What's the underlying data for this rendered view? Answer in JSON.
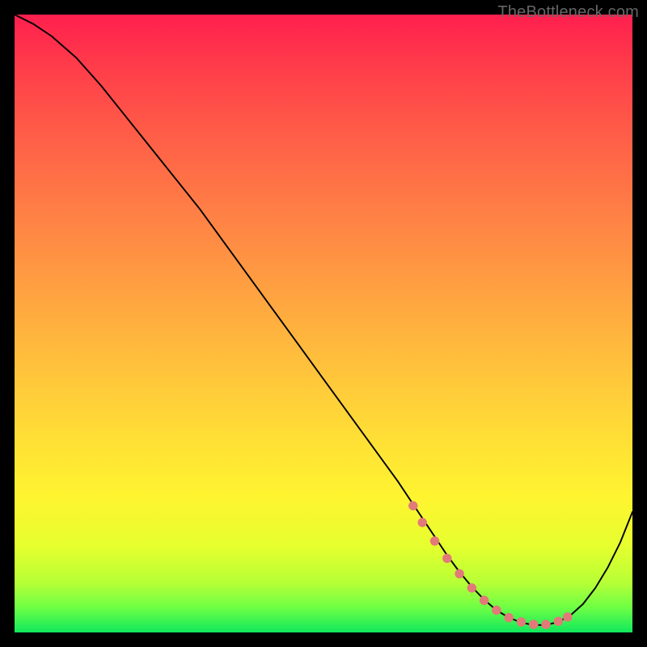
{
  "watermark": "TheBottleneck.com",
  "chart_data": {
    "type": "line",
    "title": "",
    "xlabel": "",
    "ylabel": "",
    "xlim": [
      0,
      100
    ],
    "ylim": [
      0,
      100
    ],
    "grid": false,
    "series": [
      {
        "name": "bottleneck-curve",
        "x": [
          0,
          3,
          6,
          10,
          14,
          18,
          22,
          26,
          30,
          34,
          38,
          42,
          46,
          50,
          54,
          58,
          62,
          64,
          66,
          68,
          70,
          72,
          74,
          76,
          78,
          80,
          82,
          84,
          86,
          88,
          90,
          92,
          94,
          96,
          98,
          100
        ],
        "y": [
          100,
          98.5,
          96.5,
          93,
          88.5,
          83.5,
          78.5,
          73.5,
          68.5,
          63,
          57.5,
          52,
          46.5,
          41,
          35.5,
          30,
          24.5,
          21.5,
          18.5,
          15.5,
          12.5,
          9.8,
          7.4,
          5.3,
          3.6,
          2.4,
          1.6,
          1.2,
          1.2,
          1.7,
          2.8,
          4.6,
          7.2,
          10.5,
          14.5,
          19.5
        ]
      }
    ],
    "annotations": {
      "minimum_band": {
        "color": "#e27a79",
        "points_x": [
          64.5,
          66,
          68,
          70,
          72,
          74,
          76,
          78,
          80,
          82,
          84,
          86,
          88,
          89.5
        ],
        "points_y": [
          20.5,
          17.8,
          14.8,
          12,
          9.5,
          7.2,
          5.2,
          3.6,
          2.4,
          1.7,
          1.3,
          1.3,
          1.8,
          2.5
        ]
      }
    }
  }
}
